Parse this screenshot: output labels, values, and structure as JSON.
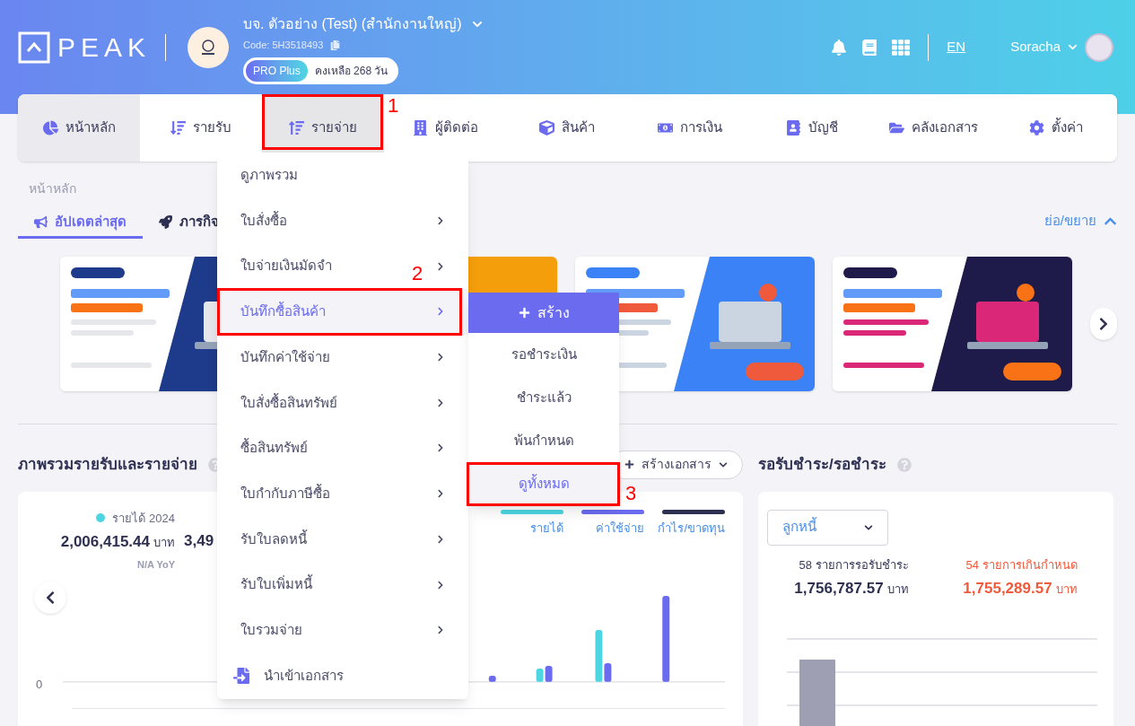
{
  "header": {
    "logo": "PEAK",
    "company_name": "บจ. ตัวอย่าง (Test) (สำนักงานใหญ่)",
    "code": "Code: 5H3518493",
    "plan": "PRO Plus",
    "remaining": "คงเหลือ 268 วัน",
    "language": "EN",
    "user": "Soracha"
  },
  "nav": [
    {
      "label": "หน้าหลัก",
      "selected": true,
      "open": false
    },
    {
      "label": "รายรับ",
      "selected": false,
      "open": false
    },
    {
      "label": "รายจ่าย",
      "selected": false,
      "open": true
    },
    {
      "label": "ผู้ติดต่อ",
      "selected": false,
      "open": false
    },
    {
      "label": "สินค้า",
      "selected": false,
      "open": false
    },
    {
      "label": "การเงิน",
      "selected": false,
      "open": false
    },
    {
      "label": "บัญชี",
      "selected": false,
      "open": false
    },
    {
      "label": "คลังเอกสาร",
      "selected": false,
      "open": false
    },
    {
      "label": "ตั้งค่า",
      "selected": false,
      "open": false
    }
  ],
  "breadcrumb": "หน้าหลัก",
  "update_tabs": [
    {
      "label": "อัปเดตล่าสุด",
      "selected": true
    },
    {
      "label": "ภารกิจ",
      "selected": false
    }
  ],
  "collapse_toggle": "ย่อ/ขยาย",
  "overview": {
    "title": "ภาพรวมรายรับและรายจ่าย",
    "create_button": "สร้างเอกสาร",
    "stats": [
      {
        "label": "รายได้ 2024",
        "color": "#4dd6e2",
        "value": "2,006,415.44",
        "unit": "บาท",
        "yoy": "N/A YoY"
      },
      {
        "value": "3,49"
      }
    ],
    "legend": [
      {
        "label": "รายได้",
        "color": "#4dd6e2"
      },
      {
        "label": "ค่าใช้จ่าย",
        "color": "#6b6bf0"
      },
      {
        "label": "กำไร/ขาดทุน",
        "color": "#2e3052"
      }
    ],
    "axis_label": "0"
  },
  "receivables": {
    "title": "รอรับชำระ/รอชำระ",
    "filter": "ลูกหนี้",
    "stats": [
      {
        "caption": "58 รายการรอรับชำระ",
        "value": "1,756,787.57",
        "unit": "บาท",
        "overdue": false
      },
      {
        "caption": "54 รายการเกินกำหนด",
        "value": "1,755,289.57",
        "unit": "บาท",
        "overdue": true
      }
    ]
  },
  "menu": [
    {
      "label": "ดูภาพรวม",
      "kind": "plain",
      "selected": false
    },
    {
      "label": "ใบสั่งซื้อ",
      "kind": "submenu",
      "selected": false
    },
    {
      "label": "ใบจ่ายเงินมัดจำ",
      "kind": "submenu",
      "selected": false
    },
    {
      "label": "บันทึกซื้อสินค้า",
      "kind": "submenu",
      "selected": true
    },
    {
      "label": "บันทึกค่าใช้จ่าย",
      "kind": "submenu",
      "selected": false
    },
    {
      "label": "ใบสั่งซื้อสินทรัพย์",
      "kind": "submenu",
      "selected": false
    },
    {
      "label": "ซื้อสินทรัพย์",
      "kind": "submenu",
      "selected": false
    },
    {
      "label": "ใบกำกับภาษีซื้อ",
      "kind": "submenu",
      "selected": false
    },
    {
      "label": "รับใบลดหนี้",
      "kind": "submenu",
      "selected": false
    },
    {
      "label": "รับใบเพิ่มหนี้",
      "kind": "submenu",
      "selected": false
    },
    {
      "label": "ใบรวมจ่าย",
      "kind": "submenu",
      "selected": false
    },
    {
      "label": "นำเข้าเอกสาร",
      "kind": "import",
      "selected": false
    }
  ],
  "submenu": [
    {
      "label": "สร้าง",
      "kind": "create",
      "selected": false
    },
    {
      "label": "รอชำระเงิน",
      "kind": "link",
      "selected": false
    },
    {
      "label": "ชำระแล้ว",
      "kind": "link",
      "selected": false
    },
    {
      "label": "พ้นกำหนด",
      "kind": "link",
      "selected": false
    },
    {
      "label": "ดูทั้งหมด",
      "kind": "link",
      "selected": true
    }
  ],
  "annotations": [
    {
      "label": "1"
    },
    {
      "label": "2"
    },
    {
      "label": "3"
    }
  ]
}
